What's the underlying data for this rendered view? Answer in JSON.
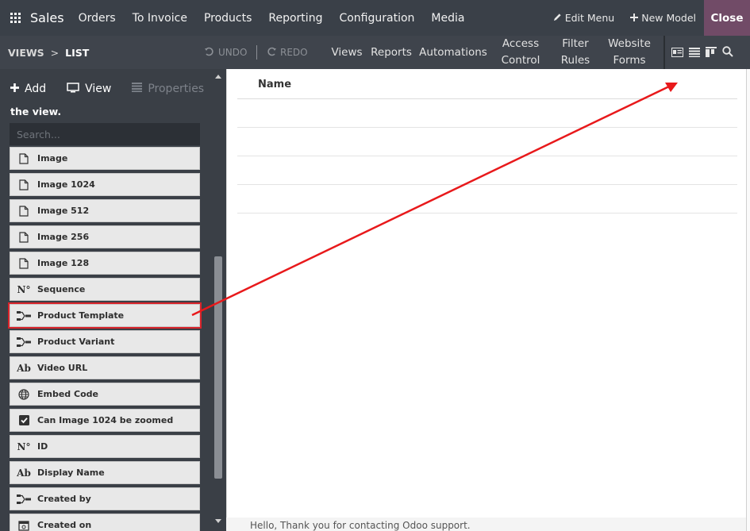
{
  "topbar": {
    "app_name": "Sales",
    "menus": [
      "Orders",
      "To Invoice",
      "Products",
      "Reporting",
      "Configuration",
      "Media"
    ],
    "edit_menu": "Edit Menu",
    "new_model": "New Model",
    "close": "Close"
  },
  "subbar": {
    "breadcrumb_root": "VIEWS",
    "breadcrumb_sep": ">",
    "breadcrumb_current": "LIST",
    "undo": "UNDO",
    "redo": "REDO",
    "nav": {
      "views": "Views",
      "reports": "Reports",
      "automations": "Automations",
      "access_1": "Access",
      "access_2": "Control",
      "filter_1": "Filter",
      "filter_2": "Rules",
      "website_1": "Website",
      "website_2": "Forms"
    }
  },
  "sidebar": {
    "tabs": {
      "add": "Add",
      "view": "View",
      "properties": "Properties"
    },
    "note": "the view.",
    "search_placeholder": "Search...",
    "fields": [
      {
        "label": "Image",
        "icon": "file-icon"
      },
      {
        "label": "Image 1024",
        "icon": "file-icon"
      },
      {
        "label": "Image 512",
        "icon": "file-icon"
      },
      {
        "label": "Image 256",
        "icon": "file-icon"
      },
      {
        "label": "Image 128",
        "icon": "file-icon"
      },
      {
        "label": "Sequence",
        "icon": "number-icon",
        "glyph": "N°"
      },
      {
        "label": "Product Template",
        "icon": "relation-icon"
      },
      {
        "label": "Product Variant",
        "icon": "relation-icon"
      },
      {
        "label": "Video URL",
        "icon": "text-icon",
        "glyph": "Ab"
      },
      {
        "label": "Embed Code",
        "icon": "globe-icon"
      },
      {
        "label": "Can Image 1024 be zoomed",
        "icon": "checkbox-icon"
      },
      {
        "label": "ID",
        "icon": "number-icon",
        "glyph": "N°"
      },
      {
        "label": "Display Name",
        "icon": "text-icon",
        "glyph": "Ab"
      },
      {
        "label": "Created by",
        "icon": "relation-icon"
      },
      {
        "label": "Created on",
        "icon": "calendar-icon"
      }
    ]
  },
  "list": {
    "column_name": "Name"
  },
  "background": {
    "text": "Hello, Thank you for contacting Odoo support."
  },
  "colors": {
    "topbar": "#3a4048",
    "subbar": "#3f444c",
    "sidebar": "#3a3f46",
    "close_button": "#714b67",
    "highlight": "#d8232a",
    "arrow": "#e8191b"
  }
}
